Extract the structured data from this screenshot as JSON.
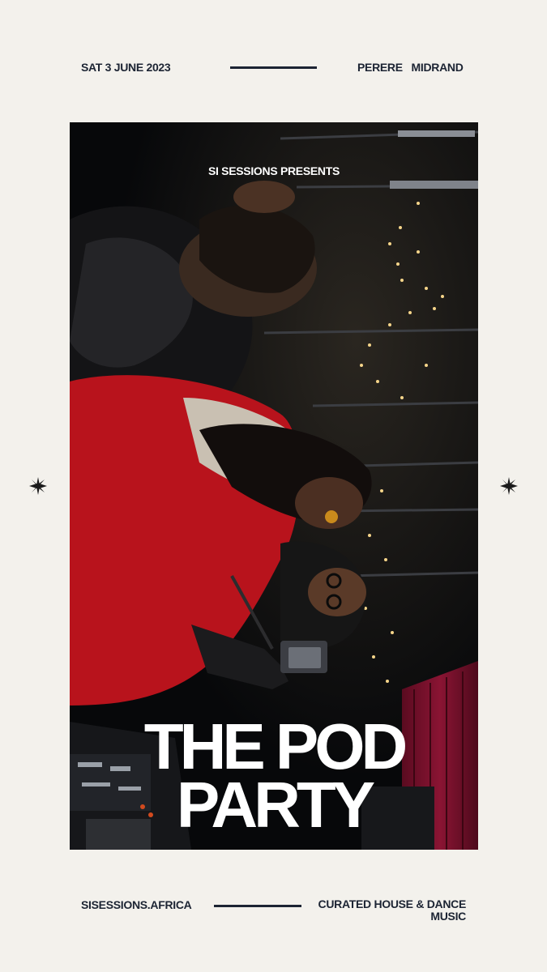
{
  "header": {
    "date": "SAT 3 JUNE 2023",
    "venue": "PERERE   MIDRAND"
  },
  "poster": {
    "presenter": "SI SESSIONS PRESENTS",
    "title_line1": "THE POD",
    "title_line2": "PARTY"
  },
  "footer": {
    "website": "SISESSIONS.AFRICA",
    "tagline_line1": "CURATED HOUSE & DANCE",
    "tagline_line2": "MUSIC"
  },
  "colors": {
    "background": "#f3f1ec",
    "ink": "#1c2433",
    "photo_dark": "#0a0b0d",
    "jacket_red": "#b8131c",
    "curtain": "#7a0f2b"
  },
  "icons": {
    "left_ornament": "starburst",
    "right_ornament": "starburst"
  }
}
